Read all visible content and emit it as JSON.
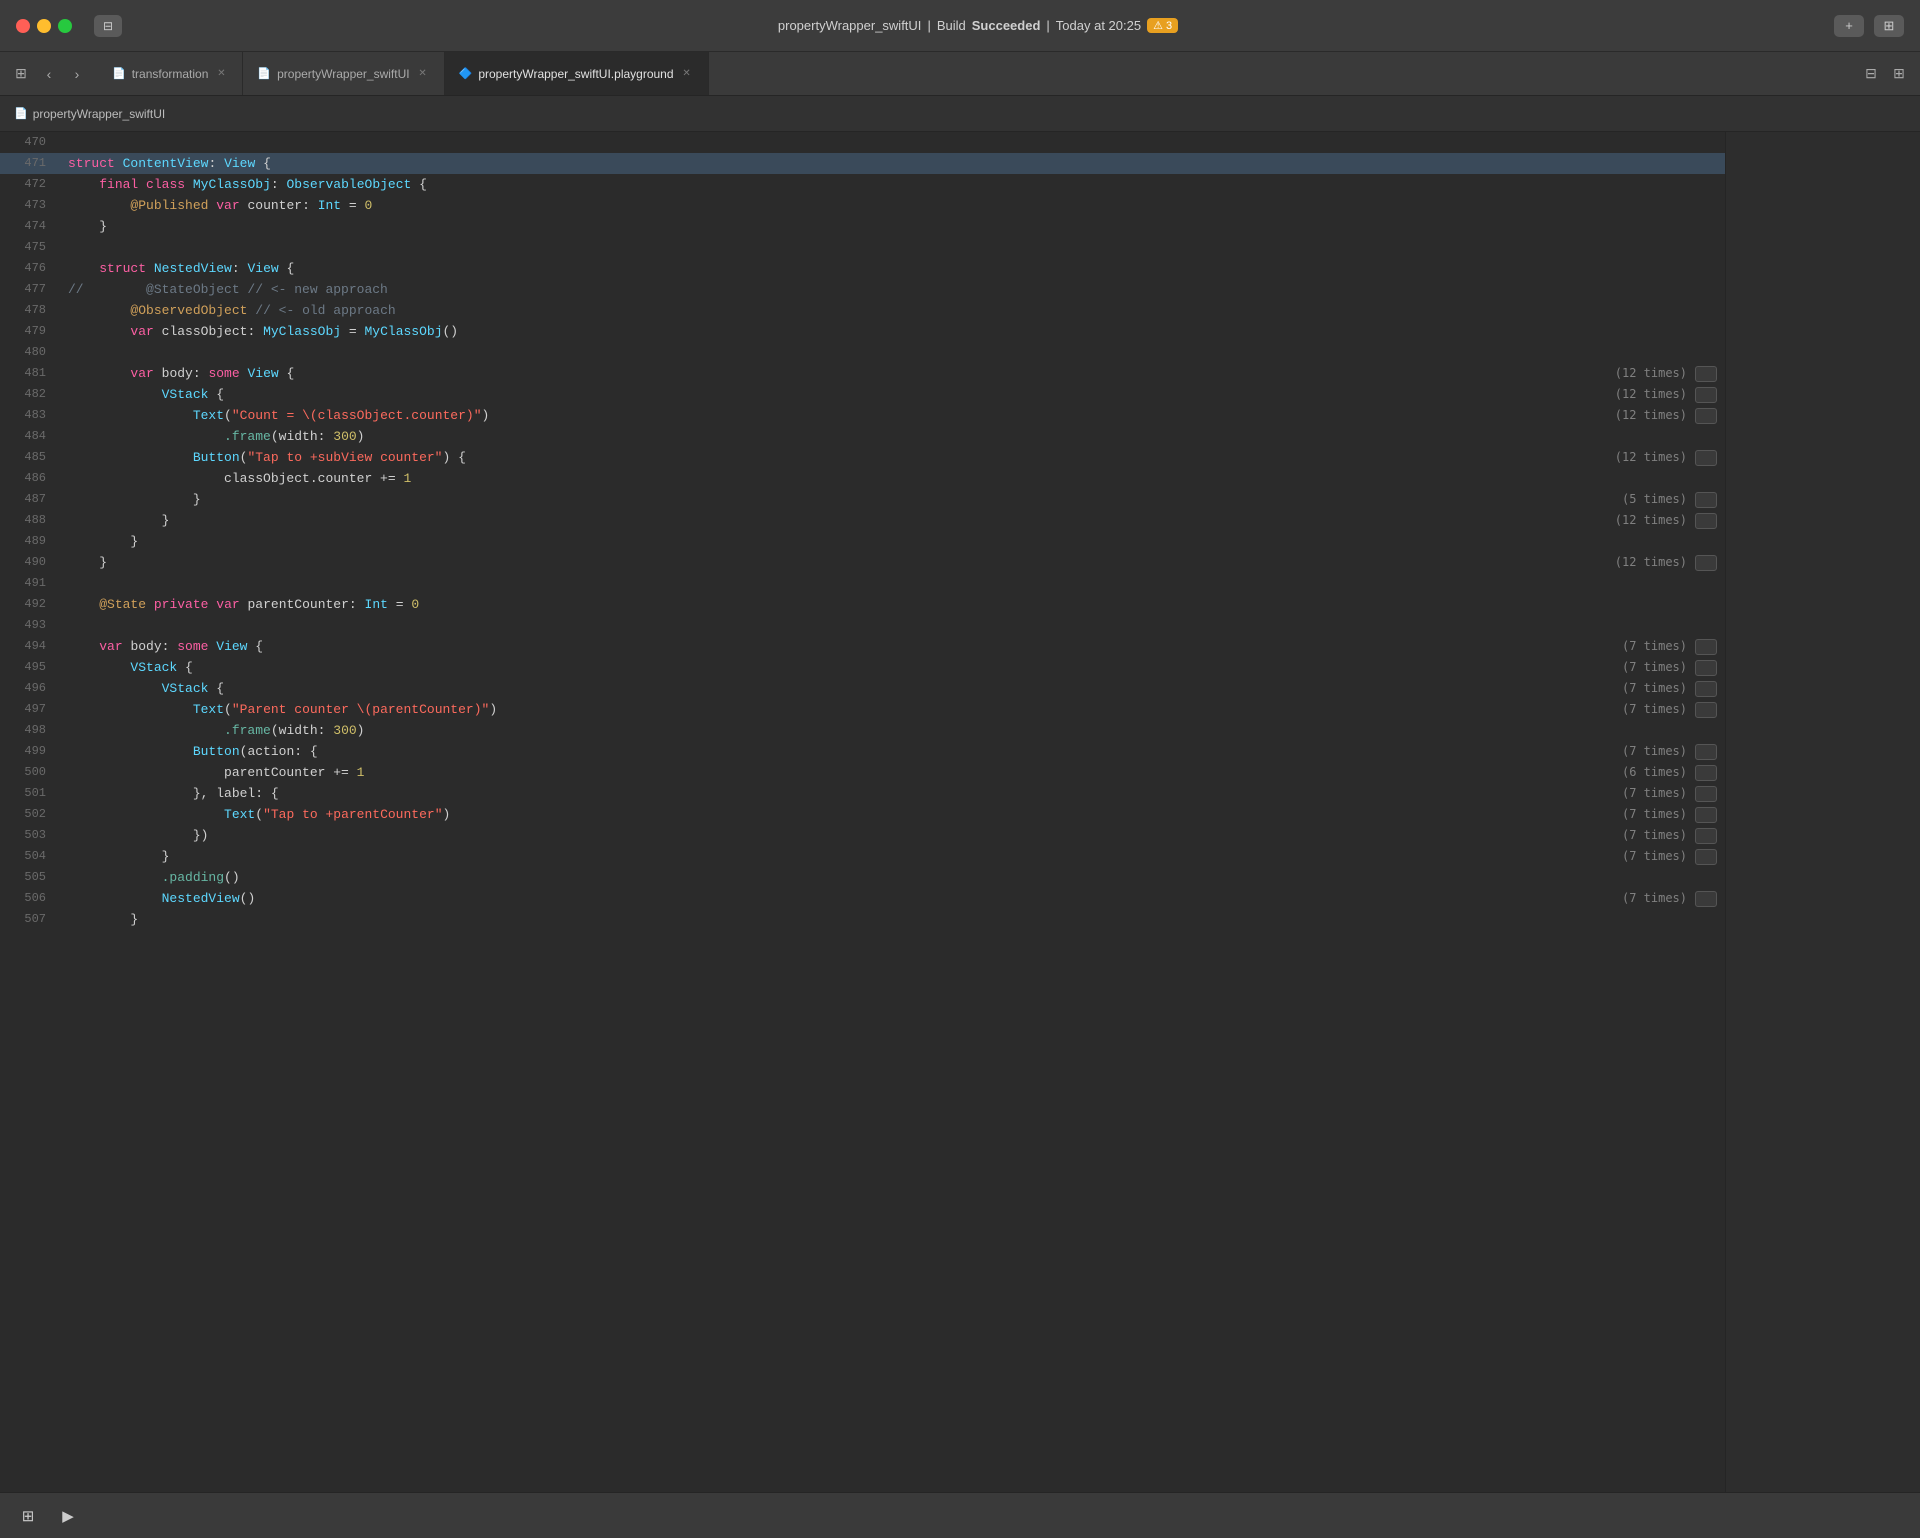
{
  "titlebar": {
    "project": "propertyWrapper_swiftUI",
    "separator": "|",
    "build_label": "Build",
    "status": "Succeeded",
    "time_label": "Today at 20:25",
    "warning_icon": "⚠",
    "warning_count": "3",
    "sidebar_icon": "⊞",
    "add_icon": "+",
    "layout_icon": "⊟"
  },
  "tabs": [
    {
      "id": "transformation",
      "label": "transformation",
      "icon": "📄",
      "active": false
    },
    {
      "id": "propertyWrapper_swiftUI",
      "label": "propertyWrapper_swiftUI",
      "icon": "📄",
      "active": false
    },
    {
      "id": "propertyWrapper_swiftUI_playground",
      "label": "propertyWrapper_swiftUI.playground",
      "icon": "🔷",
      "active": true
    }
  ],
  "breadcrumb": {
    "label": "propertyWrapper_swiftUI"
  },
  "lines": [
    {
      "num": 470,
      "content": "",
      "highlight": false,
      "annotation": ""
    },
    {
      "num": 471,
      "content": "struct ContentView: View {",
      "highlight": true,
      "annotation": ""
    },
    {
      "num": 472,
      "content": "    final class MyClassObj: ObservableObject {",
      "highlight": false,
      "annotation": ""
    },
    {
      "num": 473,
      "content": "        @Published var counter: Int = 0",
      "highlight": false,
      "annotation": ""
    },
    {
      "num": 474,
      "content": "    }",
      "highlight": false,
      "annotation": ""
    },
    {
      "num": 475,
      "content": "",
      "highlight": false,
      "annotation": ""
    },
    {
      "num": 476,
      "content": "    struct NestedView: View {",
      "highlight": false,
      "annotation": ""
    },
    {
      "num": 477,
      "content": "//        @StateObject // <- new approach",
      "highlight": false,
      "annotation": ""
    },
    {
      "num": 478,
      "content": "        @ObservedObject // <- old approach",
      "highlight": false,
      "annotation": ""
    },
    {
      "num": 479,
      "content": "        var classObject: MyClassObj = MyClassObj()",
      "highlight": false,
      "annotation": ""
    },
    {
      "num": 480,
      "content": "",
      "highlight": false,
      "annotation": ""
    },
    {
      "num": 481,
      "content": "        var body: some View {",
      "highlight": false,
      "annotation": "(12 times)"
    },
    {
      "num": 482,
      "content": "            VStack {",
      "highlight": false,
      "annotation": "(12 times)"
    },
    {
      "num": 483,
      "content": "                Text(\"Count = \\(classObject.counter)\")",
      "highlight": false,
      "annotation": "(12 times)"
    },
    {
      "num": 484,
      "content": "                    .frame(width: 300)",
      "highlight": false,
      "annotation": ""
    },
    {
      "num": 485,
      "content": "                Button(\"Tap to +subView counter\") {",
      "highlight": false,
      "annotation": "(12 times)"
    },
    {
      "num": 486,
      "content": "                    classObject.counter += 1",
      "highlight": false,
      "annotation": ""
    },
    {
      "num": 487,
      "content": "                }",
      "highlight": false,
      "annotation": "(5 times)"
    },
    {
      "num": 488,
      "content": "            }",
      "highlight": false,
      "annotation": "(12 times)"
    },
    {
      "num": 489,
      "content": "        }",
      "highlight": false,
      "annotation": ""
    },
    {
      "num": 490,
      "content": "    }",
      "highlight": false,
      "annotation": "(12 times)"
    },
    {
      "num": 491,
      "content": "",
      "highlight": false,
      "annotation": ""
    },
    {
      "num": 492,
      "content": "    @State private var parentCounter: Int = 0",
      "highlight": false,
      "annotation": ""
    },
    {
      "num": 493,
      "content": "",
      "highlight": false,
      "annotation": ""
    },
    {
      "num": 494,
      "content": "    var body: some View {",
      "highlight": false,
      "annotation": "(7 times)"
    },
    {
      "num": 495,
      "content": "        VStack {",
      "highlight": false,
      "annotation": "(7 times)"
    },
    {
      "num": 496,
      "content": "            VStack {",
      "highlight": false,
      "annotation": "(7 times)"
    },
    {
      "num": 497,
      "content": "                Text(\"Parent counter \\(parentCounter)\")",
      "highlight": false,
      "annotation": "(7 times)"
    },
    {
      "num": 498,
      "content": "                    .frame(width: 300)",
      "highlight": false,
      "annotation": ""
    },
    {
      "num": 499,
      "content": "                Button(action: {",
      "highlight": false,
      "annotation": "(7 times)"
    },
    {
      "num": 500,
      "content": "                    parentCounter += 1",
      "highlight": false,
      "annotation": "(6 times)"
    },
    {
      "num": 501,
      "content": "                }, label: {",
      "highlight": false,
      "annotation": "(7 times)"
    },
    {
      "num": 502,
      "content": "                    Text(\"Tap to +parentCounter\")",
      "highlight": false,
      "annotation": "(7 times)"
    },
    {
      "num": 503,
      "content": "                })",
      "highlight": false,
      "annotation": "(7 times)"
    },
    {
      "num": 504,
      "content": "            }",
      "highlight": false,
      "annotation": "(7 times)"
    },
    {
      "num": 505,
      "content": "            .padding()",
      "highlight": false,
      "annotation": ""
    },
    {
      "num": 506,
      "content": "            NestedView()",
      "highlight": false,
      "annotation": "(7 times)"
    },
    {
      "num": 507,
      "content": "        }",
      "highlight": false,
      "annotation": ""
    }
  ]
}
